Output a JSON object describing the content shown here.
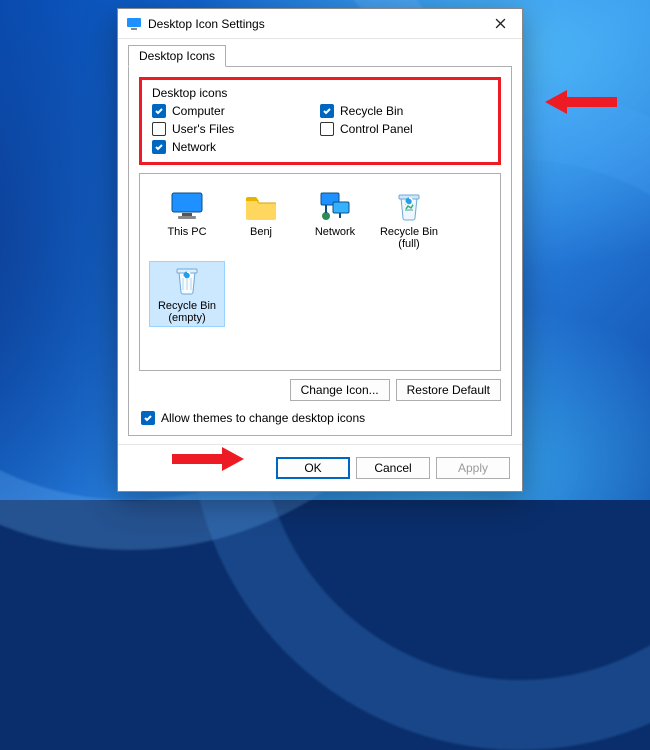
{
  "title": "Desktop Icon Settings",
  "tab": "Desktop Icons",
  "group_label": "Desktop icons",
  "checkboxes": {
    "computer": {
      "label": "Computer",
      "checked": true
    },
    "recycle_bin": {
      "label": "Recycle Bin",
      "checked": true
    },
    "users_files": {
      "label": "User's Files",
      "checked": false
    },
    "control_panel": {
      "label": "Control Panel",
      "checked": false
    },
    "network": {
      "label": "Network",
      "checked": true
    }
  },
  "preview_icons": [
    {
      "name": "This PC",
      "kind": "monitor"
    },
    {
      "name": "Benj",
      "kind": "folder"
    },
    {
      "name": "Network",
      "kind": "network"
    },
    {
      "name": "Recycle Bin (full)",
      "kind": "bin-full"
    },
    {
      "name": "Recycle Bin (empty)",
      "kind": "bin-empty"
    }
  ],
  "buttons": {
    "change_icon": "Change Icon...",
    "restore_default": "Restore Default",
    "allow_themes": "Allow themes to change desktop icons",
    "ok": "OK",
    "cancel": "Cancel",
    "apply": "Apply"
  },
  "allow_themes_checked": true,
  "selected_preview": 4
}
